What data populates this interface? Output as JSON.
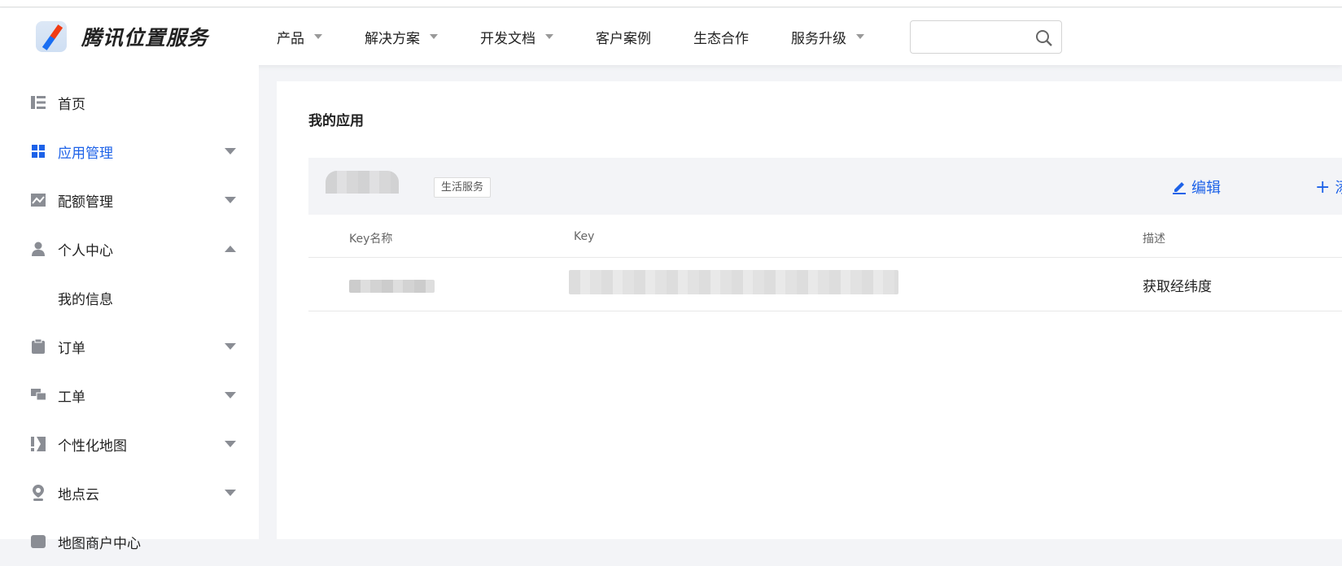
{
  "header": {
    "brand": "腾讯位置服务",
    "nav": [
      {
        "label": "产品",
        "dropdown": true
      },
      {
        "label": "解决方案",
        "dropdown": true
      },
      {
        "label": "开发文档",
        "dropdown": true
      },
      {
        "label": "客户案例",
        "dropdown": false
      },
      {
        "label": "生态合作",
        "dropdown": false
      },
      {
        "label": "服务升级",
        "dropdown": true
      }
    ],
    "search_placeholder": ""
  },
  "sidebar": {
    "items": [
      {
        "label": "首页",
        "icon": "list-icon"
      },
      {
        "label": "应用管理",
        "icon": "grid-icon",
        "active": true
      },
      {
        "label": "配额管理",
        "icon": "chart-icon"
      },
      {
        "label": "个人中心",
        "icon": "user-icon",
        "expanded": true
      },
      {
        "label": "我的信息",
        "sub": true
      },
      {
        "label": "订单",
        "icon": "clipboard-icon"
      },
      {
        "label": "工单",
        "icon": "chat-icon"
      },
      {
        "label": "个性化地图",
        "icon": "style-icon"
      },
      {
        "label": "地点云",
        "icon": "pin-icon"
      },
      {
        "label": "地图商户中心",
        "icon": "store-icon"
      }
    ]
  },
  "main": {
    "title": "我的应用",
    "app": {
      "tag": "生活服务",
      "edit_label": "编辑",
      "add_label": "添"
    },
    "table": {
      "headers": [
        "Key名称",
        "Key",
        "描述"
      ],
      "rows": [
        {
          "description": "获取经纬度"
        }
      ]
    }
  },
  "colors": {
    "accent": "#1d62e8"
  }
}
